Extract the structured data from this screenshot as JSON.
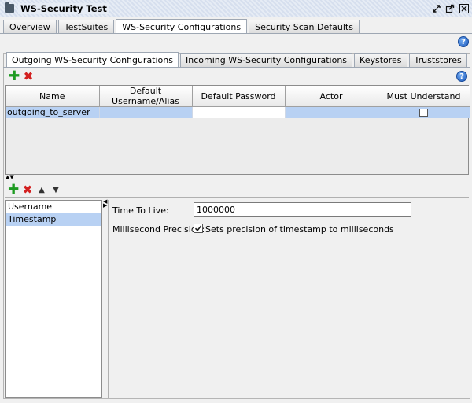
{
  "window": {
    "title": "WS-Security Test",
    "icons": [
      "folder-icon",
      "restore-icon",
      "maximize-icon",
      "close-icon"
    ]
  },
  "top_tabs": [
    {
      "label": "Overview"
    },
    {
      "label": "TestSuites"
    },
    {
      "label": "WS-Security Configurations",
      "active": true
    },
    {
      "label": "Security Scan Defaults"
    }
  ],
  "inner_tabs": [
    {
      "label": "Outgoing WS-Security Configurations",
      "active": true
    },
    {
      "label": "Incoming WS-Security Configurations"
    },
    {
      "label": "Keystores"
    },
    {
      "label": "Truststores"
    }
  ],
  "table": {
    "columns": [
      "Name",
      "Default Username/Alias",
      "Default Password",
      "Actor",
      "Must Understand"
    ],
    "rows": [
      {
        "name": "outgoing_to_server",
        "username": "",
        "password": "",
        "actor": "",
        "must_understand": false
      }
    ]
  },
  "entries": {
    "items": [
      {
        "label": "Username"
      },
      {
        "label": "Timestamp",
        "selected": true
      }
    ]
  },
  "form": {
    "ttl_label": "Time To Live:",
    "ttl_value": "1000000",
    "ms_label": "Millisecond Precision:",
    "ms_checked": true,
    "ms_text": "Sets precision of timestamp to milliseconds"
  },
  "colors": {
    "selection": "#b8d1f3",
    "add": "#1e9b22",
    "remove": "#d32020"
  }
}
